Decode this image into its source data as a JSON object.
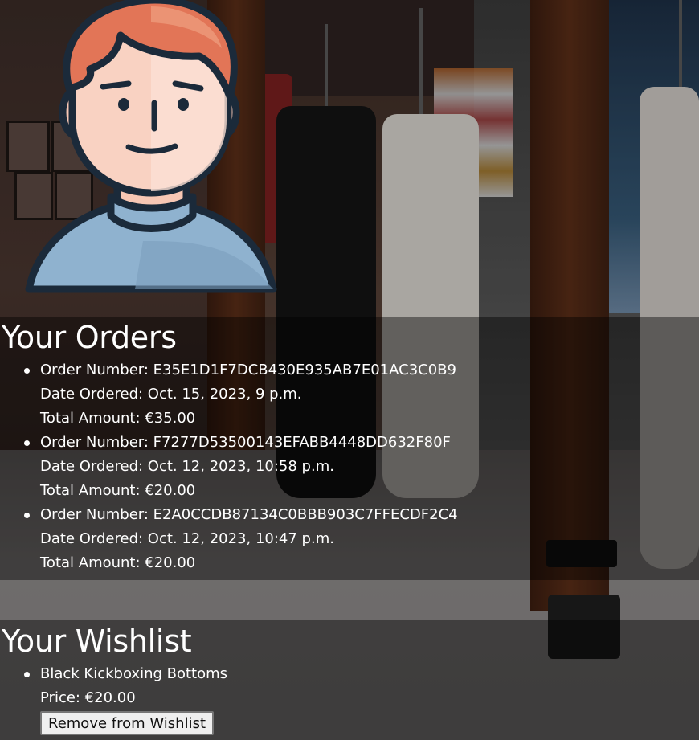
{
  "profile": {
    "avatar_icon": "user-avatar-illustration"
  },
  "orders": {
    "title": "Your Orders",
    "items": [
      {
        "number_label": "Order Number: E35E1D1F7DCB430E935AB7E01AC3C0B9",
        "date_label": "Date Ordered: Oct. 15, 2023, 9 p.m.",
        "total_label": "Total Amount: €35.00"
      },
      {
        "number_label": "Order Number: F7277D53500143EFABB4448DD632F80F",
        "date_label": "Date Ordered: Oct. 12, 2023, 10:58 p.m.",
        "total_label": "Total Amount: €20.00"
      },
      {
        "number_label": "Order Number: E2A0CCDB87134C0BBB903C7FFECDF2C4",
        "date_label": "Date Ordered: Oct. 12, 2023, 10:47 p.m.",
        "total_label": "Total Amount: €20.00"
      }
    ]
  },
  "wishlist": {
    "title": "Your Wishlist",
    "items": [
      {
        "name": "Black Kickboxing Bottoms",
        "price_label": "Price: €20.00",
        "remove_label": "Remove from Wishlist"
      }
    ]
  }
}
